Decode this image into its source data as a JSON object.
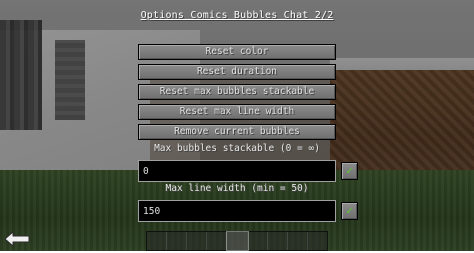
{
  "title": "Options Comics Bubbles Chat 2/2",
  "buttons": {
    "reset_color": "Reset color",
    "reset_duration": "Reset duration",
    "reset_max_bubbles": "Reset max bubbles stackable",
    "reset_max_line_width": "Reset max line width",
    "remove_bubbles": "Remove current bubbles"
  },
  "max_bubbles": {
    "label": "Max bubbles stackable (0 = ∞)",
    "value": "0",
    "confirm_icon": "✓"
  },
  "max_line_width": {
    "label": "Max line width (min = 50)",
    "value": "150",
    "confirm_icon": "✓"
  },
  "colors": {
    "confirm_check": "#59d02a",
    "button_text": "#e0e0e0",
    "field_bg": "#000000"
  },
  "icons": {
    "back": "back-arrow-icon"
  }
}
